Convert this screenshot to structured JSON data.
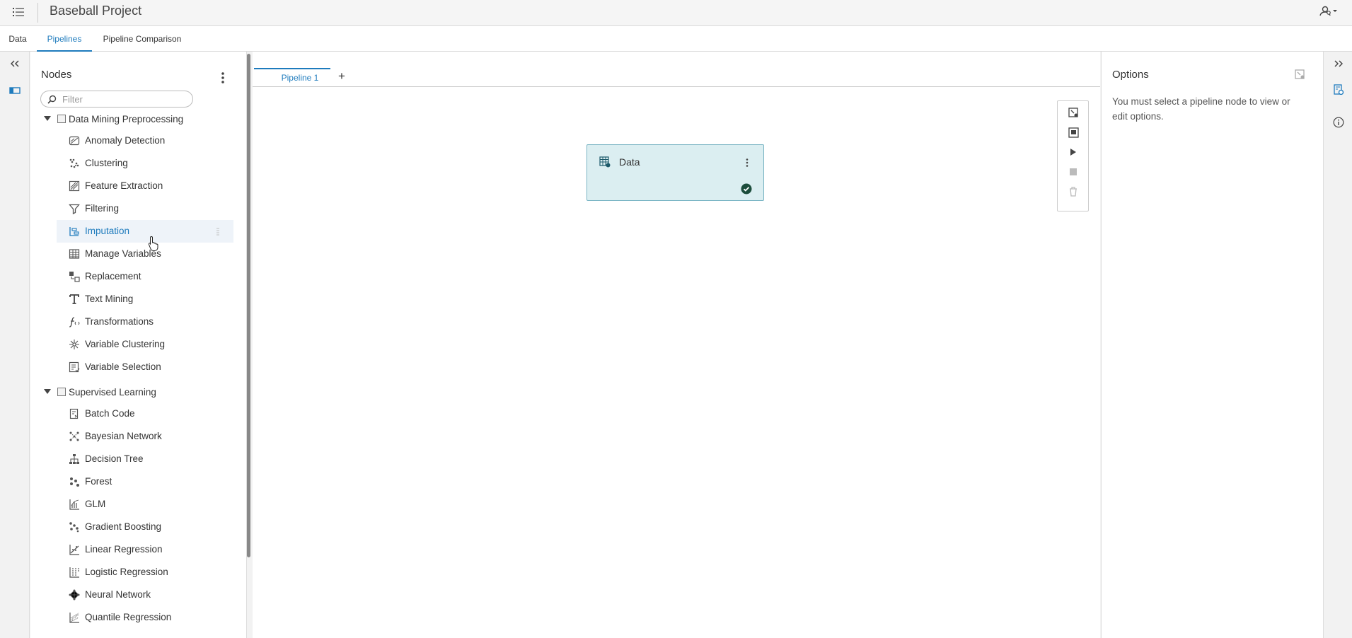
{
  "app": {
    "title": "Baseball Project"
  },
  "tabs": [
    {
      "label": "Data",
      "active": false
    },
    {
      "label": "Pipelines",
      "active": true
    },
    {
      "label": "Pipeline Comparison",
      "active": false
    }
  ],
  "nodes_panel": {
    "title": "Nodes",
    "filter_placeholder": "Filter",
    "groups": [
      {
        "label": "Data Mining Preprocessing",
        "items": [
          {
            "label": "Anomaly Detection",
            "icon": "anomaly-detection-icon"
          },
          {
            "label": "Clustering",
            "icon": "clustering-icon"
          },
          {
            "label": "Feature Extraction",
            "icon": "feature-extraction-icon"
          },
          {
            "label": "Filtering",
            "icon": "filter-funnel-icon"
          },
          {
            "label": "Imputation",
            "icon": "imputation-icon",
            "hovered": true
          },
          {
            "label": "Manage Variables",
            "icon": "table-grid-icon"
          },
          {
            "label": "Replacement",
            "icon": "replacement-icon"
          },
          {
            "label": "Text Mining",
            "icon": "text-t-icon"
          },
          {
            "label": "Transformations",
            "icon": "function-icon"
          },
          {
            "label": "Variable Clustering",
            "icon": "variable-clustering-icon"
          },
          {
            "label": "Variable Selection",
            "icon": "variable-selection-icon"
          }
        ]
      },
      {
        "label": "Supervised Learning",
        "items": [
          {
            "label": "Batch Code",
            "icon": "batch-code-icon"
          },
          {
            "label": "Bayesian Network",
            "icon": "bayesian-network-icon"
          },
          {
            "label": "Decision Tree",
            "icon": "decision-tree-icon"
          },
          {
            "label": "Forest",
            "icon": "forest-icon"
          },
          {
            "label": "GLM",
            "icon": "glm-icon"
          },
          {
            "label": "Gradient Boosting",
            "icon": "gradient-boosting-icon"
          },
          {
            "label": "Linear Regression",
            "icon": "linear-regression-icon"
          },
          {
            "label": "Logistic Regression",
            "icon": "logistic-regression-icon"
          },
          {
            "label": "Neural Network",
            "icon": "neural-network-icon"
          },
          {
            "label": "Quantile Regression",
            "icon": "quantile-regression-icon"
          }
        ]
      }
    ]
  },
  "canvas": {
    "pipeline_tab_label": "Pipeline 1",
    "add_tab_label": "+",
    "node": {
      "label": "Data",
      "status": "success"
    }
  },
  "options_panel": {
    "title": "Options",
    "message": "You must select a pipeline node to view or edit options."
  },
  "colors": {
    "accent": "#1e7bbd",
    "node_fill": "#dbeef1",
    "node_border": "#7ab5c4",
    "success": "#1c4d3c"
  }
}
